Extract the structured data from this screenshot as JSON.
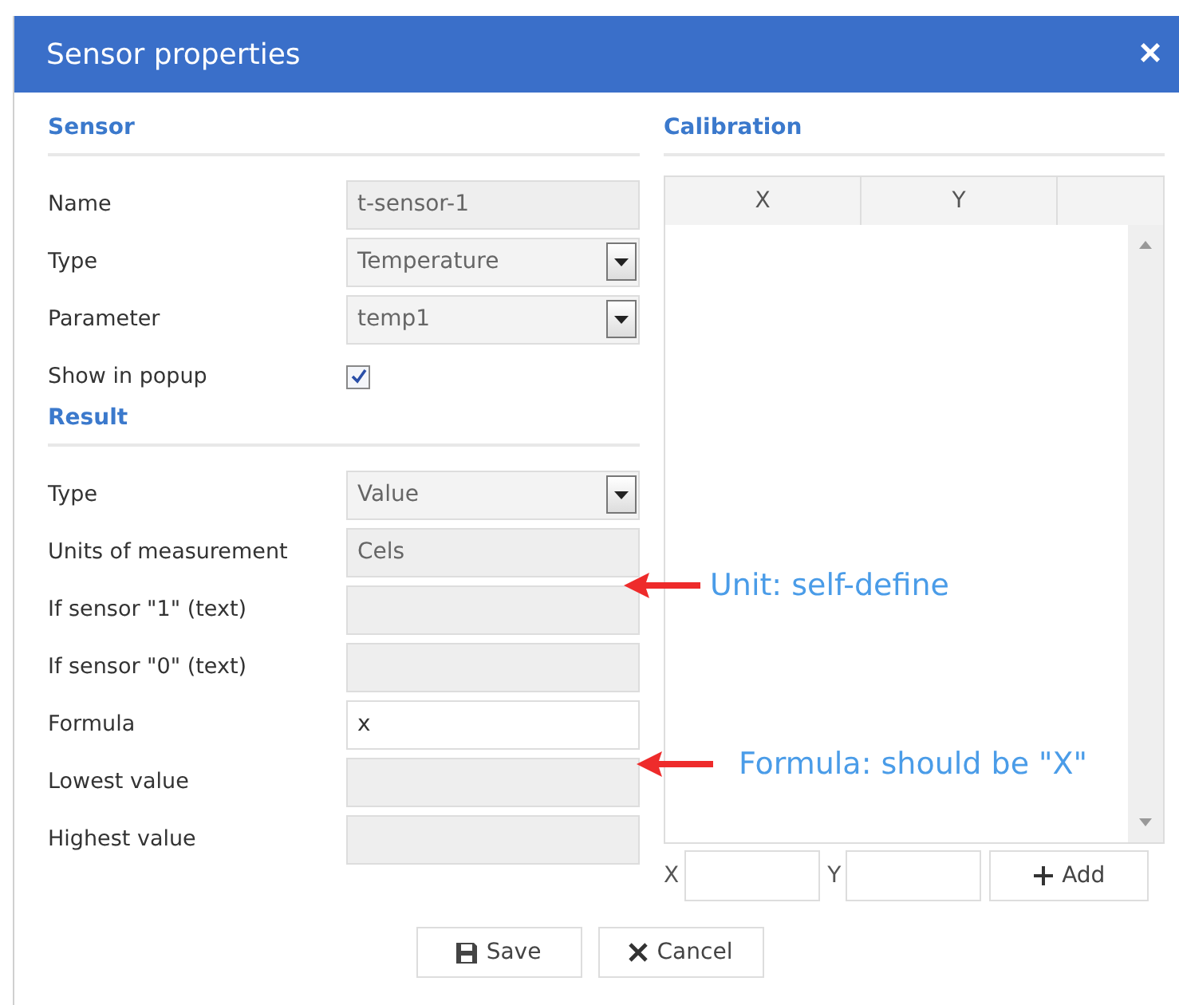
{
  "window": {
    "title": "Sensor properties",
    "close": "×"
  },
  "sections": [
    {
      "heading": "Sensor",
      "fields": [
        {
          "label": "Name",
          "kind": "text",
          "value": "t-sensor-1",
          "disabled": true
        },
        {
          "label": "Type",
          "kind": "select",
          "value": "Temperature",
          "disabled": true
        },
        {
          "label": "Parameter",
          "kind": "select",
          "value": "temp1",
          "disabled": true
        },
        {
          "label": "Show in popup",
          "kind": "checkbox",
          "checked": true
        }
      ]
    },
    {
      "heading": "Result",
      "fields": [
        {
          "label": "Type",
          "kind": "select",
          "value": "Value",
          "disabled": true
        },
        {
          "label": "Units of measurement",
          "kind": "text",
          "value": "Cels",
          "disabled": true
        },
        {
          "label": "If sensor \"1\" (text)",
          "kind": "text",
          "disabled": true
        },
        {
          "label": "If sensor \"0\" (text)",
          "kind": "text",
          "disabled": true
        },
        {
          "label": "Formula",
          "kind": "text",
          "value": "x",
          "disabled": false
        },
        {
          "label": "Lowest value",
          "kind": "text",
          "disabled": true
        },
        {
          "label": "Highest value",
          "kind": "text",
          "disabled": true
        }
      ]
    }
  ],
  "calibration": {
    "heading": "Calibration",
    "columns": [
      "X",
      "Y"
    ],
    "x_label": "X",
    "y_label": "Y",
    "add_button": "Add"
  },
  "annotations": [
    "Unit: self-define",
    "Formula: should be \"X\""
  ],
  "buttons": [
    "Save",
    "Cancel"
  ]
}
